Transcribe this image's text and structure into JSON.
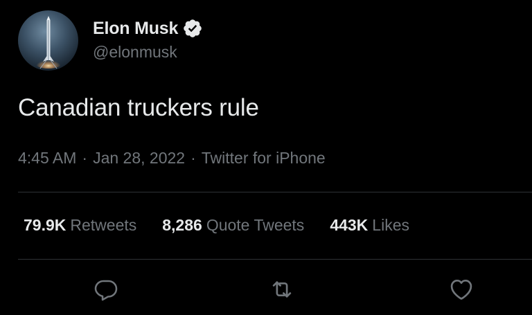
{
  "tweet": {
    "author": {
      "display_name": "Elon Musk",
      "handle": "@elonmusk",
      "verified": true,
      "avatar_icon": "rocket-launch-avatar"
    },
    "text": "Canadian truckers rule",
    "meta": {
      "time": "4:45 AM",
      "separator": "·",
      "date": "Jan 28, 2022",
      "source": "Twitter for iPhone"
    },
    "stats": {
      "retweets": {
        "count": "79.9K",
        "label": "Retweets"
      },
      "quote_tweets": {
        "count": "8,286",
        "label": "Quote Tweets"
      },
      "likes": {
        "count": "443K",
        "label": "Likes"
      }
    },
    "actions": [
      {
        "name": "reply",
        "icon": "reply-icon"
      },
      {
        "name": "retweet",
        "icon": "retweet-icon"
      },
      {
        "name": "like",
        "icon": "like-icon"
      }
    ]
  },
  "colors": {
    "background": "#000000",
    "primary_text": "#e7e9ea",
    "secondary_text": "#71767b",
    "divider": "#2f3336",
    "verified_badge": "#e7e9ea"
  }
}
